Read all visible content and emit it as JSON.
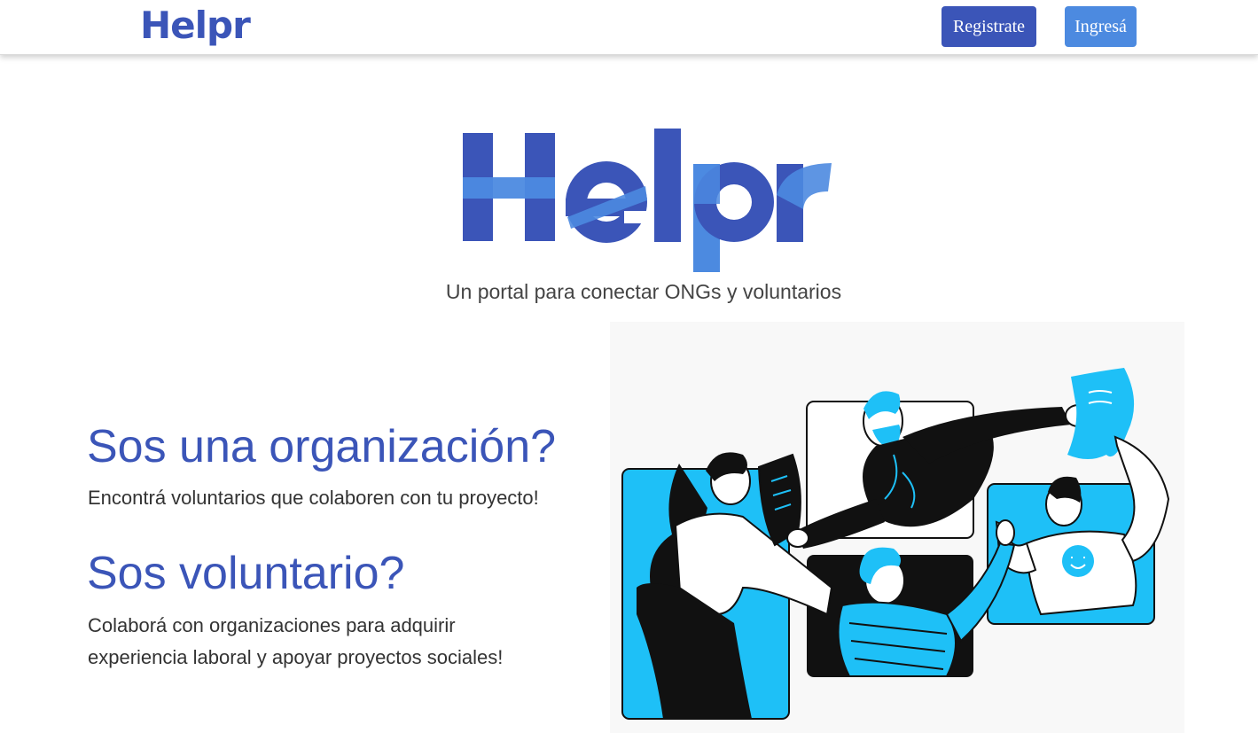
{
  "navbar": {
    "logo": "Helpr",
    "register_label": "Registrate",
    "login_label": "Ingresá"
  },
  "hero": {
    "logo": "Helpr",
    "tagline": "Un portal para conectar ONGs y voluntarios"
  },
  "sections": {
    "organization": {
      "heading": "Sos una organización?",
      "text": "Encontrá voluntarios que colaboren con tu proyecto!"
    },
    "volunteer": {
      "heading": "Sos voluntario?",
      "text": "Colaborá con organizaciones para adquirir experiencia laboral y apoyar proyectos sociales!"
    }
  },
  "colors": {
    "brand_dark": "#3b55b8",
    "brand_light": "#4c8ae0",
    "illustration_blue": "#1ec0f7"
  },
  "illustration": {
    "icon": "team-collaboration-illustration"
  }
}
